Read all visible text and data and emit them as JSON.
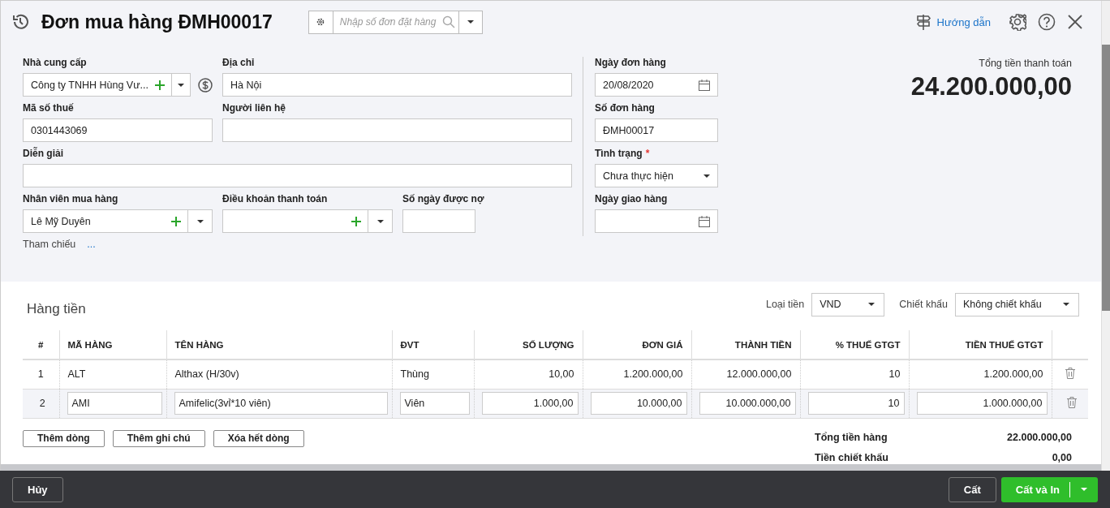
{
  "header": {
    "title": "Đơn mua hàng ĐMH00017",
    "search": {
      "placeholder": "Nhập số đơn đặt hàng"
    },
    "guide_link": "Hướng dẫn"
  },
  "form": {
    "supplier": {
      "label": "Nhà cung cấp",
      "value": "Công ty TNHH Hùng Vư..."
    },
    "address": {
      "label": "Địa chỉ",
      "value": "Hà Nội"
    },
    "tax_code": {
      "label": "Mã số thuế",
      "value": "0301443069"
    },
    "contact": {
      "label": "Người liên hệ"
    },
    "description": {
      "label": "Diễn giải"
    },
    "purchaser": {
      "label": "Nhân viên mua hàng",
      "value": "Lê Mỹ Duyên"
    },
    "payment_terms": {
      "label": "Điều khoản thanh toán"
    },
    "credit_days": {
      "label": "Số ngày được nợ"
    },
    "reference": {
      "label": "Tham chiếu",
      "link": "..."
    },
    "order_date": {
      "label": "Ngày đơn hàng",
      "value": "20/08/2020"
    },
    "order_no": {
      "label": "Số đơn hàng",
      "value": "ĐMH00017"
    },
    "status": {
      "label": "Tình trạng",
      "required_mark": "*",
      "value": "Chưa thực hiện"
    },
    "delivery_date": {
      "label": "Ngày giao hàng"
    }
  },
  "total": {
    "label": "Tổng tiền thanh toán",
    "value": "24.200.000,00"
  },
  "items": {
    "title": "Hàng tiền",
    "currency": {
      "label": "Loại tiền",
      "value": "VND"
    },
    "discount": {
      "label": "Chiết khấu",
      "value": "Không chiết khấu"
    },
    "columns": [
      "#",
      "MÃ HÀNG",
      "TÊN HÀNG",
      "ĐVT",
      "SỐ LƯỢNG",
      "ĐƠN GIÁ",
      "THÀNH TIỀN",
      "% THUẾ GTGT",
      "TIỀN THUẾ GTGT"
    ],
    "rows": [
      {
        "editing": false,
        "cells": [
          "1",
          "ALT",
          "Althax (H/30v)",
          "Thùng",
          "10,00",
          "1.200.000,00",
          "12.000.000,00",
          "10",
          "1.200.000,00"
        ]
      },
      {
        "editing": true,
        "cells": [
          "2",
          "AMI",
          "Amifelic(3vỉ*10 viên)",
          "Viên",
          "1.000,00",
          "10.000,00",
          "10.000.000,00",
          "10",
          "1.000.000,00"
        ]
      }
    ],
    "buttons": [
      "Thêm dòng",
      "Thêm ghi chú",
      "Xóa hết dòng"
    ],
    "summary": [
      {
        "label": "Tổng tiền hàng",
        "value": "22.000.000,00"
      },
      {
        "label": "Tiền chiết khấu",
        "value": "0,00"
      }
    ]
  },
  "footer": {
    "cancel": "Hủy",
    "save": "Cất",
    "save_print": "Cất và In"
  }
}
